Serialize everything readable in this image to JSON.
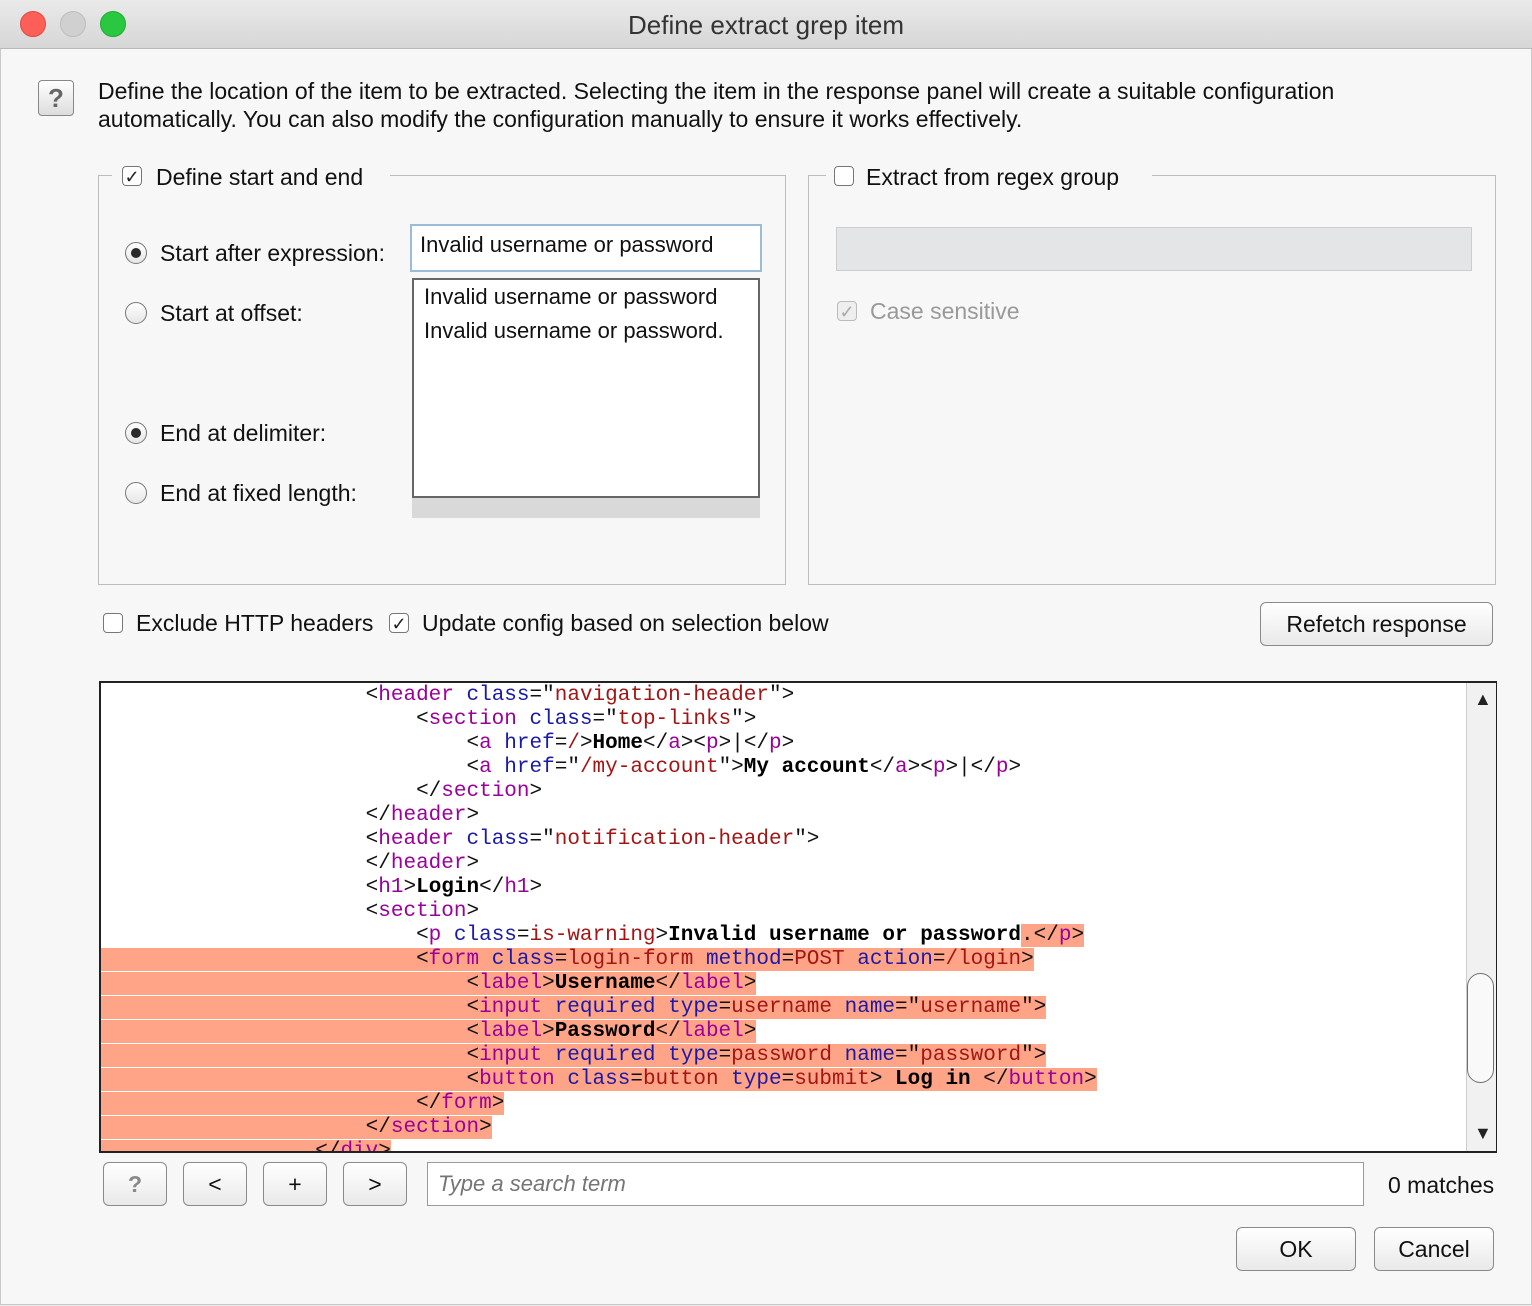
{
  "window": {
    "title": "Define extract grep item"
  },
  "description": {
    "line1": "Define the location of the item to be extracted. Selecting the item in the response panel will create a suitable configuration",
    "line2": "automatically. You can also modify the configuration manually to ensure it works effectively."
  },
  "start_end_group": {
    "label": "Define start and end",
    "checked": true,
    "start_after_label": "Start after expression:",
    "start_after_value": "Invalid username or password",
    "start_offset_label": "Start at offset:",
    "end_delimiter_label": "End at delimiter:",
    "end_fixed_label": "End at fixed length:",
    "suggestions": [
      "Invalid username or password",
      "Invalid username or password."
    ]
  },
  "regex_group": {
    "label": "Extract from regex group",
    "checked": false,
    "case_sensitive_label": "Case sensitive"
  },
  "options": {
    "exclude_headers_label": "Exclude HTTP headers",
    "update_config_label": "Update config based on selection below",
    "refetch_label": "Refetch response"
  },
  "search": {
    "placeholder": "Type a search term",
    "matches": "0 matches",
    "help_label": "?",
    "prev_label": "<",
    "add_label": "+",
    "next_label": ">"
  },
  "footer": {
    "ok_label": "OK",
    "cancel_label": "Cancel"
  },
  "colors": {
    "highlight": "#ffa487",
    "tag": "#9b009b",
    "attribute": "#1a1aa6",
    "value": "#a31515"
  },
  "code_lines": [
    {
      "indent": 20,
      "hl": "none",
      "tokens": [
        [
          "p",
          "<"
        ],
        [
          "t",
          "header"
        ],
        [
          "p",
          " "
        ],
        [
          "a",
          "class"
        ],
        [
          "p",
          "=\""
        ],
        [
          "v",
          "navigation-header"
        ],
        [
          "p",
          "\">"
        ]
      ]
    },
    {
      "indent": 24,
      "hl": "none",
      "tokens": [
        [
          "p",
          "<"
        ],
        [
          "t",
          "section"
        ],
        [
          "p",
          " "
        ],
        [
          "a",
          "class"
        ],
        [
          "p",
          "=\""
        ],
        [
          "v",
          "top-links"
        ],
        [
          "p",
          "\">"
        ]
      ]
    },
    {
      "indent": 28,
      "hl": "none",
      "tokens": [
        [
          "p",
          "<"
        ],
        [
          "t",
          "a"
        ],
        [
          "p",
          " "
        ],
        [
          "a",
          "href"
        ],
        [
          "p",
          "="
        ],
        [
          "v",
          "/"
        ],
        [
          "p",
          ">"
        ],
        [
          "b",
          "Home"
        ],
        [
          "p",
          "</"
        ],
        [
          "t",
          "a"
        ],
        [
          "p",
          "><"
        ],
        [
          "t",
          "p"
        ],
        [
          "p",
          ">|</"
        ],
        [
          "t",
          "p"
        ],
        [
          "p",
          ">"
        ]
      ]
    },
    {
      "indent": 28,
      "hl": "none",
      "tokens": [
        [
          "p",
          "<"
        ],
        [
          "t",
          "a"
        ],
        [
          "p",
          " "
        ],
        [
          "a",
          "href"
        ],
        [
          "p",
          "=\""
        ],
        [
          "v",
          "/my-account"
        ],
        [
          "p",
          "\">"
        ],
        [
          "b",
          "My account"
        ],
        [
          "p",
          "</"
        ],
        [
          "t",
          "a"
        ],
        [
          "p",
          "><"
        ],
        [
          "t",
          "p"
        ],
        [
          "p",
          ">|</"
        ],
        [
          "t",
          "p"
        ],
        [
          "p",
          ">"
        ]
      ]
    },
    {
      "indent": 24,
      "hl": "none",
      "tokens": [
        [
          "p",
          "</"
        ],
        [
          "t",
          "section"
        ],
        [
          "p",
          ">"
        ]
      ]
    },
    {
      "indent": 20,
      "hl": "none",
      "tokens": [
        [
          "p",
          "</"
        ],
        [
          "t",
          "header"
        ],
        [
          "p",
          ">"
        ]
      ]
    },
    {
      "indent": 20,
      "hl": "none",
      "tokens": [
        [
          "p",
          "<"
        ],
        [
          "t",
          "header"
        ],
        [
          "p",
          " "
        ],
        [
          "a",
          "class"
        ],
        [
          "p",
          "=\""
        ],
        [
          "v",
          "notification-header"
        ],
        [
          "p",
          "\">"
        ]
      ]
    },
    {
      "indent": 20,
      "hl": "none",
      "tokens": [
        [
          "p",
          "</"
        ],
        [
          "t",
          "header"
        ],
        [
          "p",
          ">"
        ]
      ]
    },
    {
      "indent": 20,
      "hl": "none",
      "tokens": [
        [
          "p",
          "<"
        ],
        [
          "t",
          "h1"
        ],
        [
          "p",
          ">"
        ],
        [
          "b",
          "Login"
        ],
        [
          "p",
          "</"
        ],
        [
          "t",
          "h1"
        ],
        [
          "p",
          ">"
        ]
      ]
    },
    {
      "indent": 20,
      "hl": "none",
      "tokens": [
        [
          "p",
          "<"
        ],
        [
          "t",
          "section"
        ],
        [
          "p",
          ">"
        ]
      ]
    },
    {
      "indent": 24,
      "hl": "partial",
      "tokens": [
        [
          "p",
          "<"
        ],
        [
          "t",
          "p"
        ],
        [
          "p",
          " "
        ],
        [
          "a",
          "class"
        ],
        [
          "p",
          "="
        ],
        [
          "v",
          "is-warning"
        ],
        [
          "p",
          ">"
        ],
        [
          "b",
          "Invalid username or password"
        ],
        [
          "H",
          "."
        ],
        [
          "H",
          "</"
        ],
        [
          "Ht",
          "p"
        ],
        [
          "H",
          ">"
        ]
      ]
    },
    {
      "indent": 24,
      "hl": "full",
      "tokens": [
        [
          "p",
          "<"
        ],
        [
          "t",
          "form"
        ],
        [
          "p",
          " "
        ],
        [
          "a",
          "class"
        ],
        [
          "p",
          "="
        ],
        [
          "v",
          "login-form"
        ],
        [
          "p",
          " "
        ],
        [
          "a",
          "method"
        ],
        [
          "p",
          "="
        ],
        [
          "v",
          "POST"
        ],
        [
          "p",
          " "
        ],
        [
          "a",
          "action"
        ],
        [
          "p",
          "="
        ],
        [
          "v",
          "/login"
        ],
        [
          "p",
          ">"
        ]
      ]
    },
    {
      "indent": 28,
      "hl": "full",
      "tokens": [
        [
          "p",
          "<"
        ],
        [
          "t",
          "label"
        ],
        [
          "p",
          ">"
        ],
        [
          "b",
          "Username"
        ],
        [
          "p",
          "</"
        ],
        [
          "t",
          "label"
        ],
        [
          "p",
          ">"
        ]
      ]
    },
    {
      "indent": 28,
      "hl": "full",
      "tokens": [
        [
          "p",
          "<"
        ],
        [
          "t",
          "input"
        ],
        [
          "p",
          " "
        ],
        [
          "a",
          "required"
        ],
        [
          "p",
          " "
        ],
        [
          "a",
          "type"
        ],
        [
          "p",
          "="
        ],
        [
          "v",
          "username"
        ],
        [
          "p",
          " "
        ],
        [
          "a",
          "name"
        ],
        [
          "p",
          "=\""
        ],
        [
          "v",
          "username"
        ],
        [
          "p",
          "\">"
        ]
      ]
    },
    {
      "indent": 28,
      "hl": "full",
      "tokens": [
        [
          "p",
          "<"
        ],
        [
          "t",
          "label"
        ],
        [
          "p",
          ">"
        ],
        [
          "b",
          "Password"
        ],
        [
          "p",
          "</"
        ],
        [
          "t",
          "label"
        ],
        [
          "p",
          ">"
        ]
      ]
    },
    {
      "indent": 28,
      "hl": "full",
      "tokens": [
        [
          "p",
          "<"
        ],
        [
          "t",
          "input"
        ],
        [
          "p",
          " "
        ],
        [
          "a",
          "required"
        ],
        [
          "p",
          " "
        ],
        [
          "a",
          "type"
        ],
        [
          "p",
          "="
        ],
        [
          "v",
          "password"
        ],
        [
          "p",
          " "
        ],
        [
          "a",
          "name"
        ],
        [
          "p",
          "=\""
        ],
        [
          "v",
          "password"
        ],
        [
          "p",
          "\">"
        ]
      ]
    },
    {
      "indent": 28,
      "hl": "full",
      "tokens": [
        [
          "p",
          "<"
        ],
        [
          "t",
          "button"
        ],
        [
          "p",
          " "
        ],
        [
          "a",
          "class"
        ],
        [
          "p",
          "="
        ],
        [
          "v",
          "button"
        ],
        [
          "p",
          " "
        ],
        [
          "a",
          "type"
        ],
        [
          "p",
          "="
        ],
        [
          "v",
          "submit"
        ],
        [
          "p",
          "> "
        ],
        [
          "b",
          "Log in"
        ],
        [
          "p",
          " </"
        ],
        [
          "t",
          "button"
        ],
        [
          "p",
          ">"
        ]
      ]
    },
    {
      "indent": 24,
      "hl": "full",
      "tokens": [
        [
          "p",
          "</"
        ],
        [
          "t",
          "form"
        ],
        [
          "p",
          ">"
        ]
      ]
    },
    {
      "indent": 20,
      "hl": "full",
      "tokens": [
        [
          "p",
          "</"
        ],
        [
          "t",
          "section"
        ],
        [
          "p",
          ">"
        ]
      ]
    },
    {
      "indent": 16,
      "hl": "full",
      "tokens": [
        [
          "p",
          "</"
        ],
        [
          "t",
          "div"
        ],
        [
          "p",
          ">"
        ]
      ]
    }
  ]
}
